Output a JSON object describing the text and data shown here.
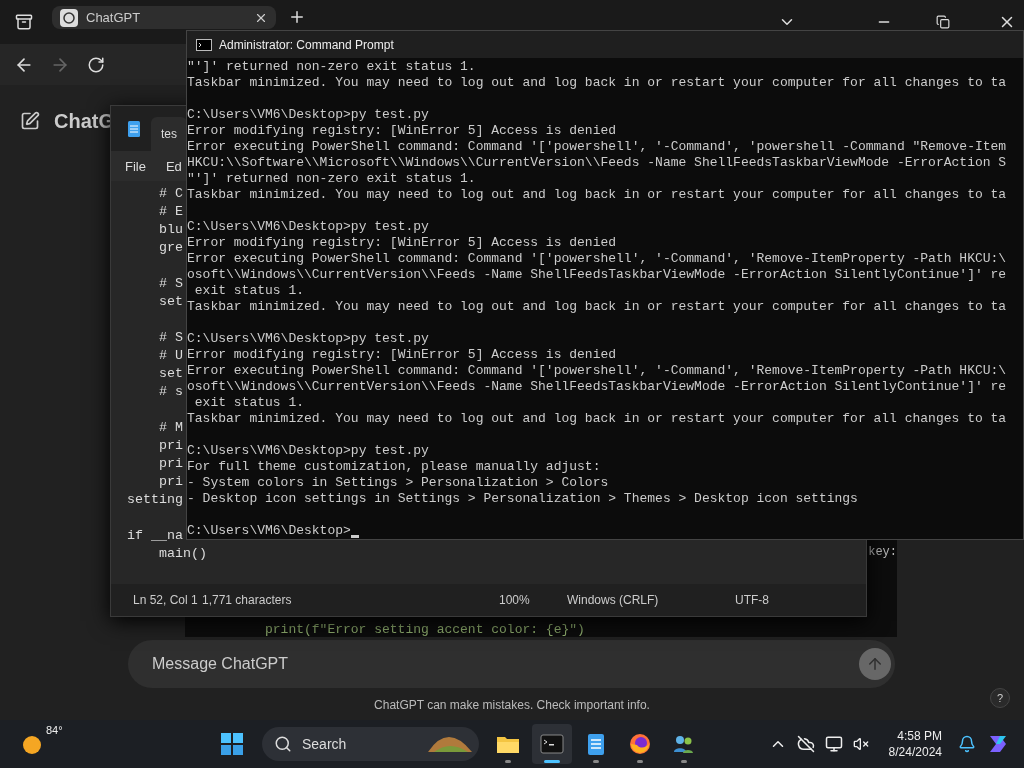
{
  "browser": {
    "tab": {
      "title": "ChatGPT",
      "selected": true
    },
    "back": {
      "disabled": false
    },
    "forward": {
      "disabled": true
    }
  },
  "chat": {
    "title": "ChatG",
    "code": {
      "line_1": "key:",
      "line_2": "print(f\"Error setting accent color: {e}\")"
    },
    "composer": {
      "placeholder": "Message ChatGPT",
      "send_disabled": true
    },
    "disclaimer": "ChatGPT can make mistakes. Check important info.",
    "help": "?"
  },
  "notepad": {
    "tab": {
      "label": "tes",
      "selected": true
    },
    "menu": [
      "File",
      "Ed"
    ],
    "groups": [
      [
        "    # C",
        "    # E",
        "    blu",
        "    gre"
      ],
      [
        "    # S",
        "    set"
      ],
      [
        "    # S",
        "    # U",
        "    set",
        "    # s"
      ],
      [
        "    # M",
        "    pri",
        "    pri",
        "    pri",
        "setting"
      ],
      [
        "if __na",
        "    main()"
      ]
    ],
    "status": [
      "Ln 52, Col 1",
      "1,771 characters",
      "100%",
      "Windows (CRLF)",
      "UTF-8"
    ]
  },
  "cmd": {
    "title": "Administrator: Command Prompt",
    "blocks": [
      [
        "\"']' returned non-zero exit status 1.",
        "Taskbar minimized. You may need to log out and log back in or restart your computer for all changes to ta"
      ],
      [
        "C:\\Users\\VM6\\Desktop>py test.py",
        "Error modifying registry: [WinError 5] Access is denied",
        "Error executing PowerShell command: Command '['powershell', '-Command', 'powershell -Command \"Remove-Item",
        "HKCU:\\\\Software\\\\Microsoft\\\\Windows\\\\CurrentVersion\\\\Feeds -Name ShellFeedsTaskbarViewMode -ErrorAction S",
        "\"']' returned non-zero exit status 1.",
        "Taskbar minimized. You may need to log out and log back in or restart your computer for all changes to ta"
      ],
      [
        "C:\\Users\\VM6\\Desktop>py test.py",
        "Error modifying registry: [WinError 5] Access is denied",
        "Error executing PowerShell command: Command '['powershell', '-Command', 'Remove-ItemProperty -Path HKCU:\\",
        "osoft\\\\Windows\\\\CurrentVersion\\\\Feeds -Name ShellFeedsTaskbarViewMode -ErrorAction SilentlyContinue']' re",
        " exit status 1.",
        "Taskbar minimized. You may need to log out and log back in or restart your computer for all changes to ta"
      ],
      [
        "C:\\Users\\VM6\\Desktop>py test.py",
        "Error modifying registry: [WinError 5] Access is denied",
        "Error executing PowerShell command: Command '['powershell', '-Command', 'Remove-ItemProperty -Path HKCU:\\",
        "osoft\\\\Windows\\\\CurrentVersion\\\\Feeds -Name ShellFeedsTaskbarViewMode -ErrorAction SilentlyContinue']' re",
        " exit status 1.",
        "Taskbar minimized. You may need to log out and log back in or restart your computer for all changes to ta"
      ],
      [
        "C:\\Users\\VM6\\Desktop>py test.py",
        "For full theme customization, please manually adjust:",
        "- System colors in Settings > Personalization > Colors",
        "- Desktop icon settings in Settings > Personalization > Themes > Desktop icon settings"
      ]
    ],
    "prompt": "C:\\Users\\VM6\\Desktop>"
  },
  "taskbar": {
    "weather": "84°",
    "search": {
      "placeholder": "Search"
    },
    "apps": [
      {
        "kind": "folder",
        "active": false
      },
      {
        "kind": "terminal",
        "active": true
      },
      {
        "kind": "notepad",
        "active": false
      },
      {
        "kind": "browser",
        "active": false
      },
      {
        "kind": "people",
        "active": false
      }
    ],
    "clock": {
      "time": "4:58 PM",
      "date": "8/24/2024"
    }
  }
}
